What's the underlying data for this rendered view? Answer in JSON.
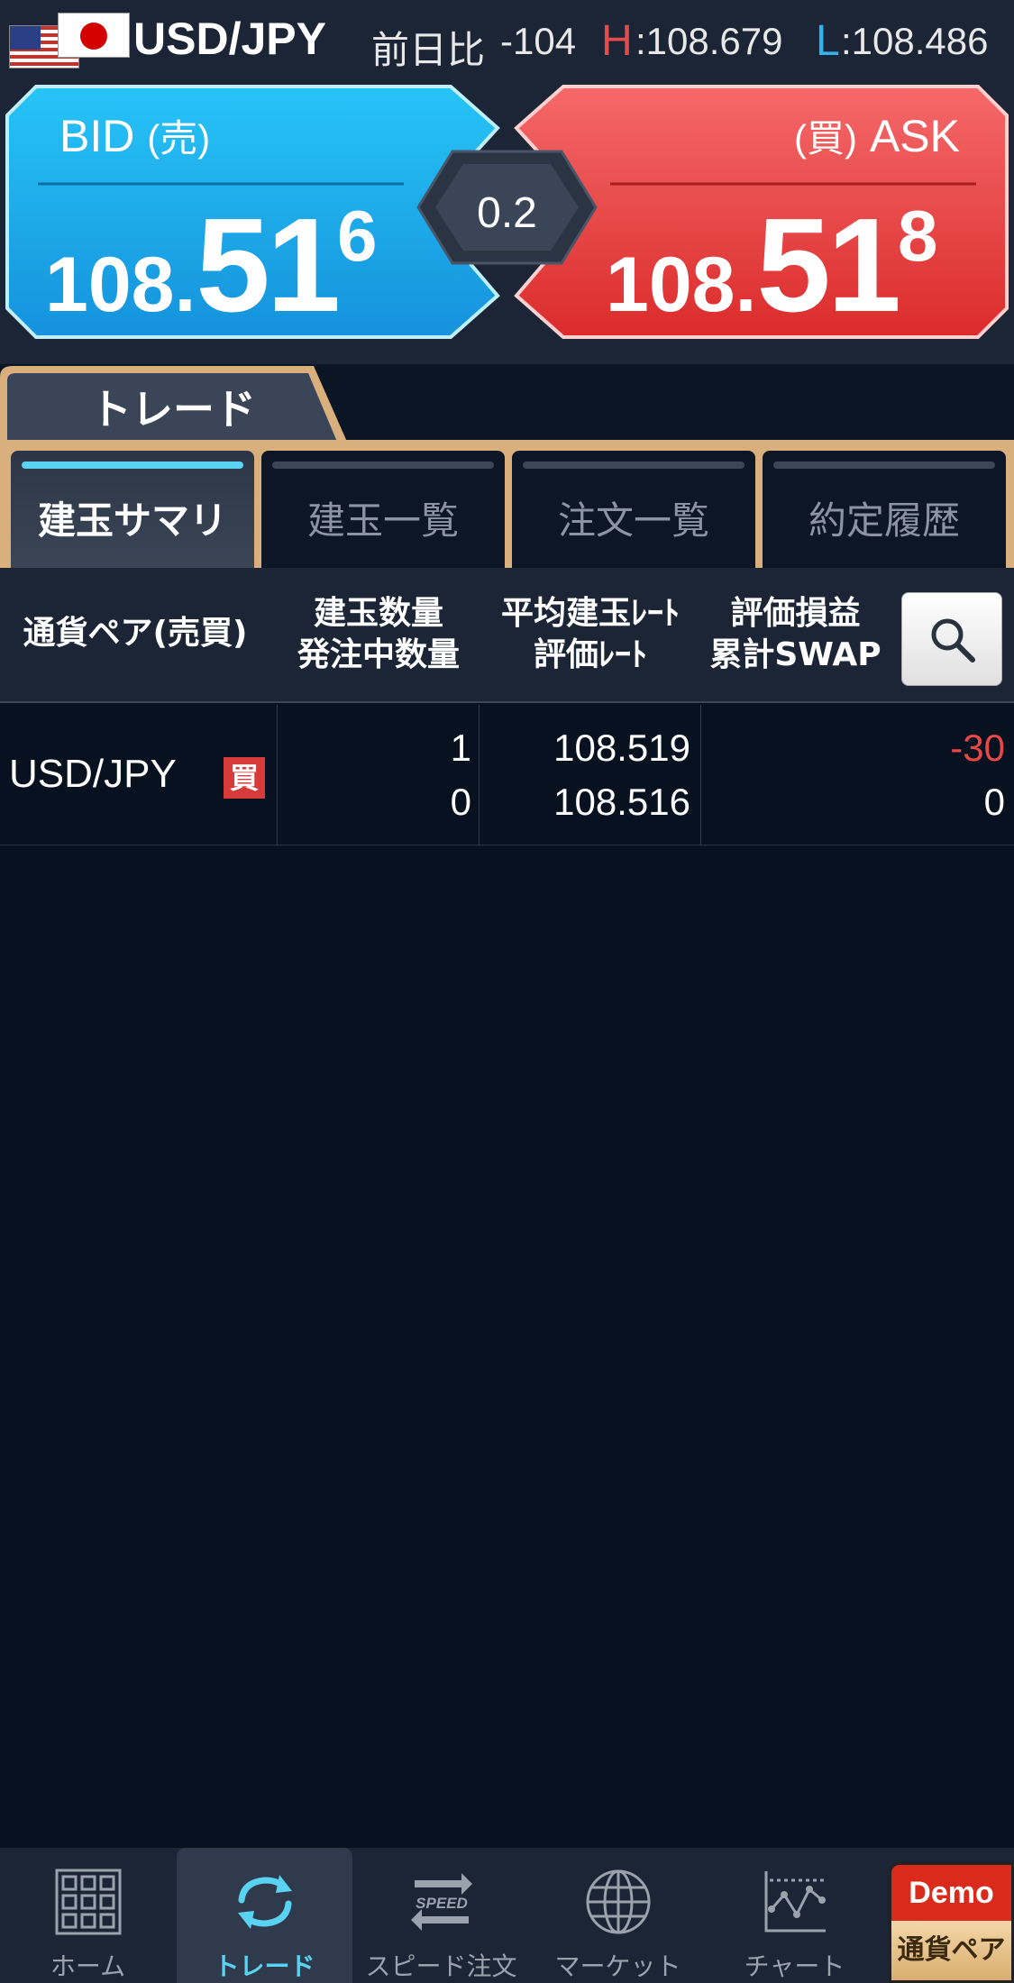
{
  "header": {
    "pair": "USD/JPY",
    "change_label": "前日比",
    "change_value": "-104",
    "high_label": "H",
    "high_value": ":108.679",
    "low_label": "L",
    "low_value": ":108.486"
  },
  "prices": {
    "bid_label": "BID",
    "bid_sub": "(売)",
    "bid_prefix": "108.",
    "bid_big": "51",
    "bid_pip": "6",
    "ask_label": "ASK",
    "ask_sub": "(買)",
    "ask_prefix": "108.",
    "ask_big": "51",
    "ask_pip": "8",
    "spread": "0.2"
  },
  "trade_tab": "トレード",
  "subtabs": [
    {
      "label": "建玉サマリ"
    },
    {
      "label": "建玉一覧"
    },
    {
      "label": "注文一覧"
    },
    {
      "label": "約定履歴"
    }
  ],
  "table": {
    "headers": {
      "pair": "通貨ペア(売買)",
      "qty_1": "建玉数量",
      "qty_2": "発注中数量",
      "rate_1": "平均建玉ﾚｰﾄ",
      "rate_2": "評価ﾚｰﾄ",
      "pl_1": "評価損益",
      "pl_2": "累計SWAP"
    },
    "rows": [
      {
        "pair": "USD/JPY",
        "side": "買",
        "qty": "1",
        "pending_qty": "0",
        "avg_rate": "108.519",
        "eval_rate": "108.516",
        "pl": "-30",
        "swap": "0"
      }
    ]
  },
  "nav": [
    {
      "label": "ホーム",
      "icon": "grid-icon"
    },
    {
      "label": "トレード",
      "icon": "refresh-icon"
    },
    {
      "label": "スピード注文",
      "icon": "speed-icon"
    },
    {
      "label": "マーケット",
      "icon": "globe-icon"
    },
    {
      "label": "チャート",
      "icon": "chart-icon"
    }
  ],
  "demo": {
    "top": "Demo",
    "bottom": "通貨ペア"
  },
  "colors": {
    "bid": "#1aa4e8",
    "ask": "#e23a3a",
    "accent_gold": "#d9b07d",
    "active_tab_bar": "#5ad2f2"
  }
}
